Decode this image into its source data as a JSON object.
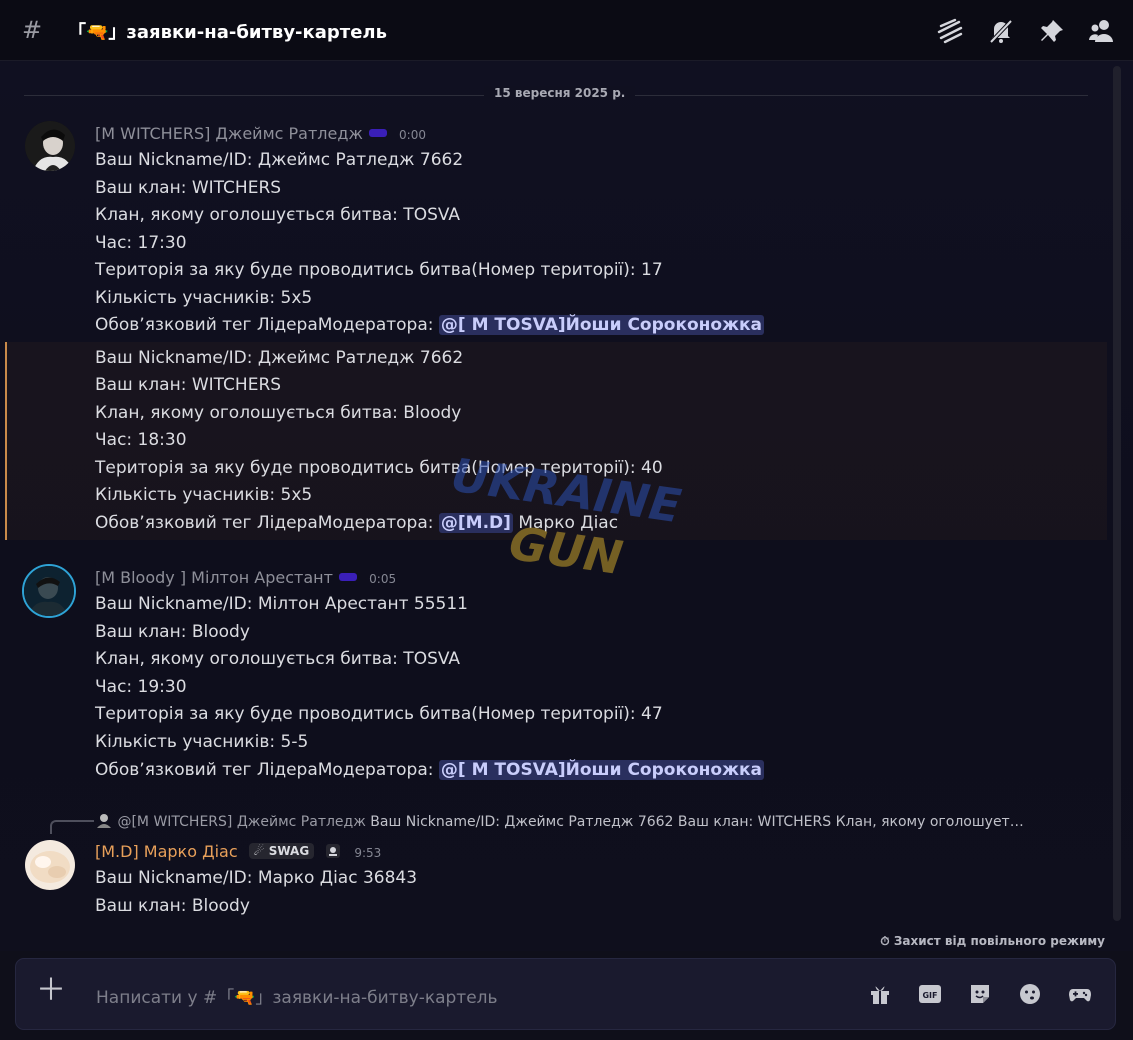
{
  "header": {
    "channel_symbol": "#",
    "channel_name": "「🔫」заявки-на-битву-картель",
    "icons": [
      "threads-icon",
      "mute-icon",
      "pin-icon",
      "members-icon"
    ]
  },
  "date_divider": "15 вересня 2025 р.",
  "messages": [
    {
      "author": "[M WITCHERS] Джеймс Ратледж",
      "time": "0:00",
      "lines": [
        "Ваш Nickname/ID: Джеймс Ратледж 7662",
        "Ваш клан: WITCHERS",
        "Клан, якому оголошується битва: TOSVA",
        "Час: 17:30",
        "Територія за яку буде проводитись битва(Номер території): 17",
        "Кількість учасників:  5х5"
      ],
      "mention_prefix": "Обовʼязковий тег ЛідераМодератора: ",
      "mention": "@[ M TOSVA]Йоши Сороконожка"
    },
    {
      "author": "",
      "time": "",
      "lines": [
        "Ваш Nickname/ID: Джеймс Ратледж 7662",
        "Ваш клан: WITCHERS",
        "Клан, якому оголошується битва: Bloody",
        "Час: 18:30",
        "Територія за яку буде проводитись битва(Номер території): 40",
        "Кількість учасників:  5х5"
      ],
      "mention_prefix": "Обовʼязковий тег ЛідераМодератора: ",
      "mention": "@[M.D]",
      "mention_suffix": " Марко Діас"
    },
    {
      "author": "[M Bloody ] Мілтон Арестант",
      "time": "0:05",
      "lines": [
        "Ваш Nickname/ID: Мілтон Арестант 55511",
        "Ваш клан: Bloody",
        "Клан, якому оголошується битва: TOSVA",
        "Час: 19:30",
        "Територія за яку буде проводитись битва(Номер території): 47",
        "Кількість учасників: 5-5"
      ],
      "mention_prefix": "Обовʼязковий тег ЛідераМодератора: ",
      "mention": "@[ M TOSVA]Йоши Сороконожка"
    },
    {
      "reply_author": "@[M WITCHERS] Джеймс Ратледж",
      "reply_preview": "Ваш Nickname/ID: Джеймс Ратледж 7662 Ваш клан: WITCHERS Клан, якому оголошует…",
      "author": "[M.D] Марко Діас",
      "author_color": "#e8a05a",
      "tag": "SWAG",
      "time": "9:53",
      "lines": [
        "Ваш Nickname/ID: Марко Діас 36843",
        "Ваш клан: Bloody"
      ]
    }
  ],
  "watermark_text": "UKRAINE GUN",
  "slowmode_notice": "Захист від повільного режиму",
  "composer": {
    "placeholder": "Написати у #「🔫」заявки-на-битву-картель",
    "icons": [
      "gift-icon",
      "gif-icon",
      "sticker-icon",
      "emoji-icon",
      "apps-icon"
    ]
  }
}
